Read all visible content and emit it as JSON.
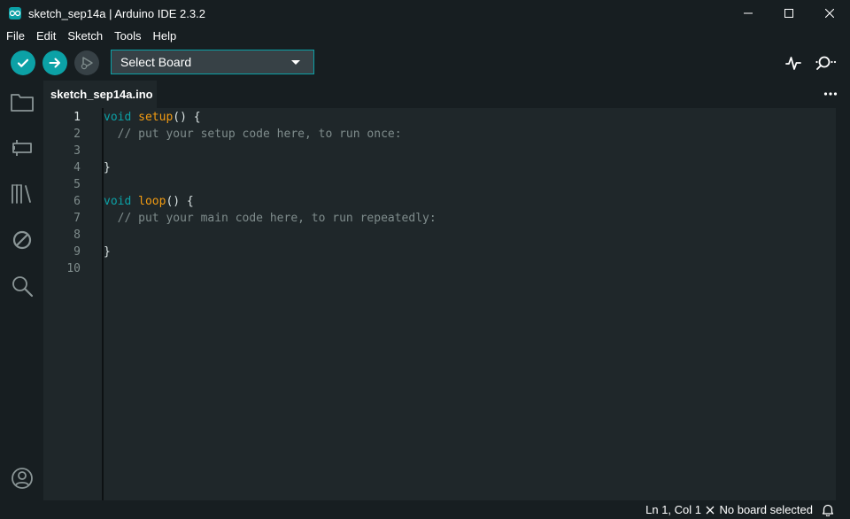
{
  "window": {
    "title": "sketch_sep14a | Arduino IDE 2.3.2",
    "app_icon": "arduino-infinity-icon",
    "controls": [
      "minimize-icon",
      "maximize-icon",
      "close-icon"
    ]
  },
  "menu": [
    "File",
    "Edit",
    "Sketch",
    "Tools",
    "Help"
  ],
  "toolbar": {
    "buttons": [
      {
        "name": "verify",
        "icon": "check-icon"
      },
      {
        "name": "upload",
        "icon": "arrow-right-icon"
      },
      {
        "name": "debug",
        "icon": "debug-icon"
      }
    ],
    "board_select_label": "Select Board",
    "right_icons": [
      "serial-plotter-icon",
      "serial-monitor-icon"
    ]
  },
  "sidebar": {
    "icons": [
      "folder-icon",
      "board-manager-icon",
      "library-icon",
      "debug-disabled-icon",
      "search-icon"
    ],
    "bottom_icon": "account-icon"
  },
  "tabs": [
    {
      "label": "sketch_sep14a.ino",
      "active": true
    }
  ],
  "editor": {
    "line_numbers": [
      "1",
      "2",
      "3",
      "4",
      "5",
      "6",
      "7",
      "8",
      "9",
      "10"
    ],
    "active_line": 1,
    "lines": [
      [
        {
          "t": "void",
          "c": "kw"
        },
        {
          "t": " ",
          "c": ""
        },
        {
          "t": "setup",
          "c": "fn"
        },
        {
          "t": "() {",
          "c": ""
        }
      ],
      [
        {
          "t": "  // put your setup code here, to run once:",
          "c": "cm"
        }
      ],
      [],
      [
        {
          "t": "}",
          "c": ""
        }
      ],
      [],
      [
        {
          "t": "void",
          "c": "kw"
        },
        {
          "t": " ",
          "c": ""
        },
        {
          "t": "loop",
          "c": "fn"
        },
        {
          "t": "() {",
          "c": ""
        }
      ],
      [
        {
          "t": "  // put your main code here, to run repeatedly:",
          "c": "cm"
        }
      ],
      [],
      [
        {
          "t": "}",
          "c": ""
        }
      ],
      []
    ]
  },
  "status": {
    "cursor_position": "Ln 1, Col 1",
    "board_status": "No board selected",
    "board_status_icon": "x-icon",
    "notification_icon": "bell-icon"
  },
  "colors": {
    "accent": "#0ca1a6",
    "background": "#171e21",
    "editor_bg": "#1f272a",
    "keyword": "#0ca1a6",
    "function": "#f39c12",
    "comment": "#7f8c8c"
  }
}
